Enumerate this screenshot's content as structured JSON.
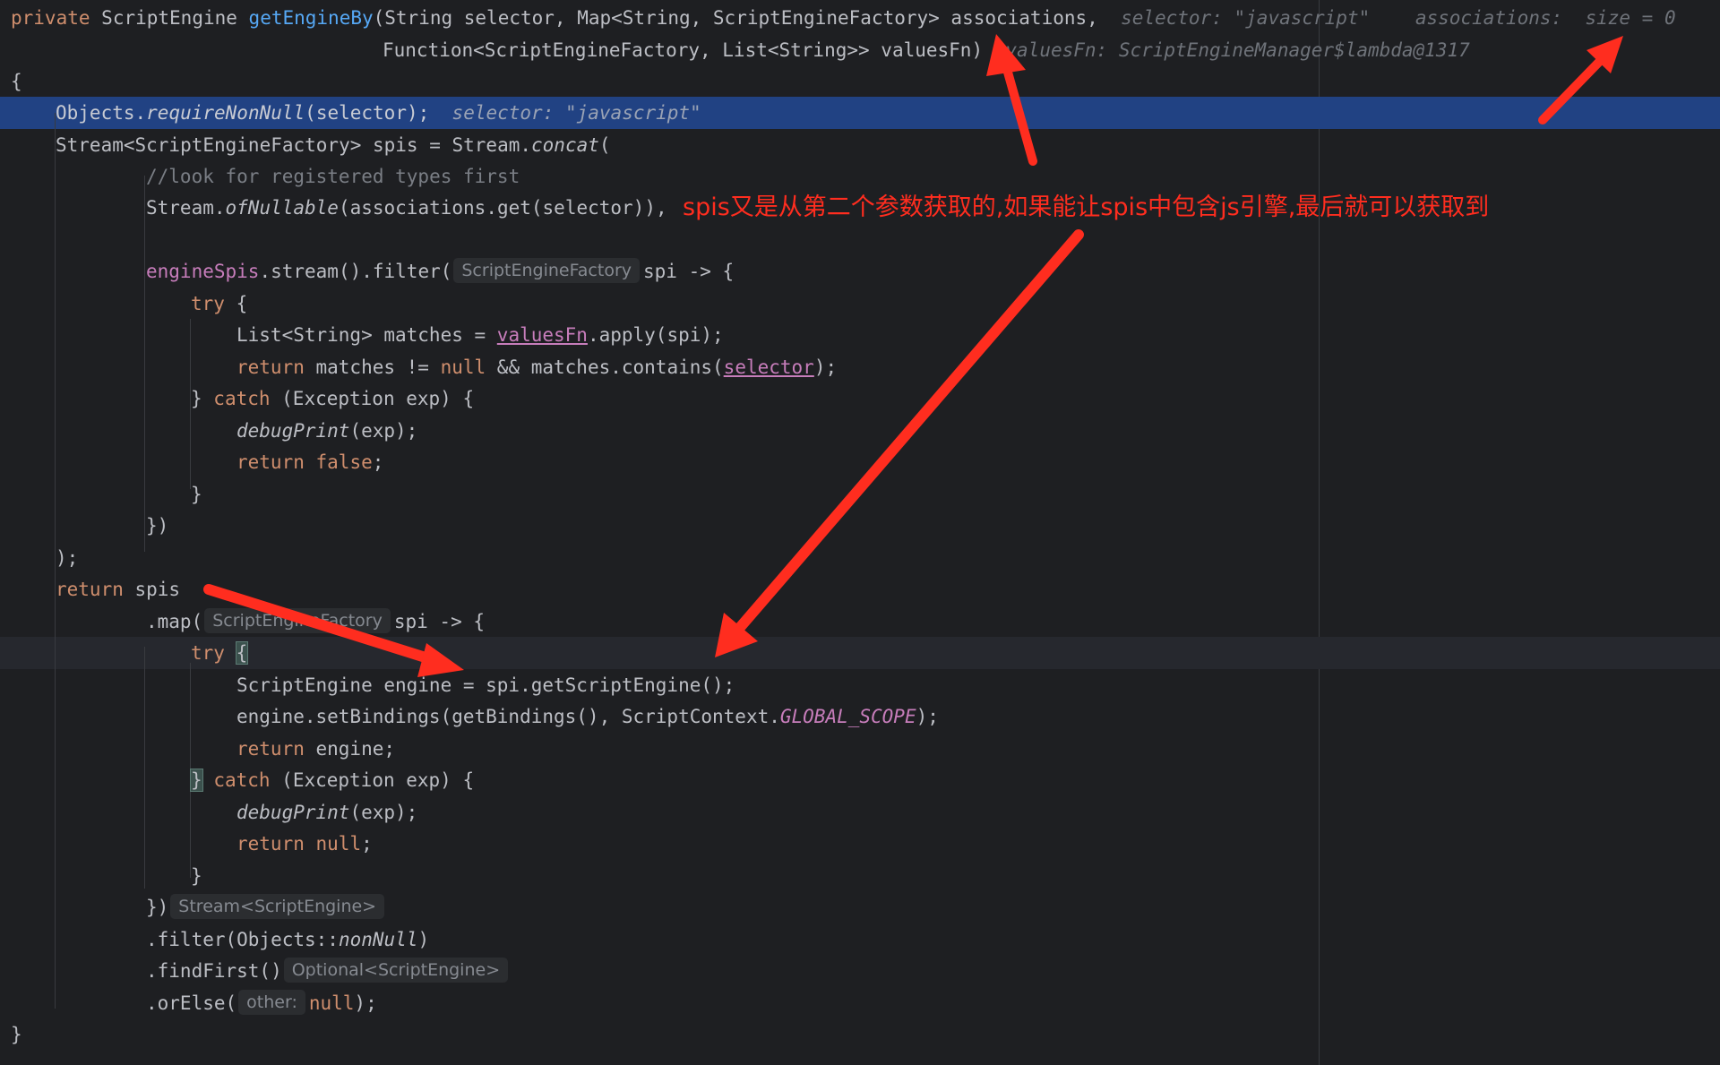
{
  "method": {
    "modifier": "private",
    "return_type": "ScriptEngine",
    "name": "getEngineBy",
    "params_line1": "(String selector, Map<String, ScriptEngineFactory> associations,",
    "params_line2": "Function<ScriptEngineFactory, List<String>> valuesFn)",
    "hint_selector": "selector: \"javascript\"",
    "hint_associations": "associations:  size = 0",
    "hint_valuesFn": "valuesFn: ScriptEngineManager$lambda@1317"
  },
  "code": {
    "open_brace": "{",
    "l4_a": "Objects.",
    "l4_b": "requireNonNull",
    "l4_c": "(selector);",
    "l4_hint": "selector: \"javascript\"",
    "l5_a": "Stream<ScriptEngineFactory> spis = Stream.",
    "l5_b": "concat",
    "l5_c": "(",
    "l6": "//look for registered types first",
    "l7_a": "Stream.",
    "l7_b": "ofNullable",
    "l7_c": "(associations.get(selector)),",
    "l8_field": "engineSpis",
    "l8_a": ".stream().filter(",
    "l8_chip": "ScriptEngineFactory",
    "l8_b": "spi -> {",
    "try": "try",
    "open": " {",
    "l10_a": "List<String> matches = ",
    "l10_b": "valuesFn",
    "l10_c": ".apply(spi);",
    "return": "return",
    "l11_a": " matches != ",
    "null": "null",
    "l11_b": " && matches.contains(",
    "l11_c": "selector",
    "l11_d": ");",
    "catch_a": "} ",
    "catch": "catch",
    "catch_b": " (Exception exp) {",
    "debugPrint": "debugPrint",
    "debug_args": "(exp);",
    "false": "false",
    "semi": ";",
    "close": "}",
    "close_paren_brace": "})",
    "close_paren_semi": ");",
    "l19_b": " spis",
    "l20_a": ".map(",
    "l20_chip": "ScriptEngineFactory",
    "l20_b": "spi -> {",
    "l21_open": "{",
    "l22": "ScriptEngine engine = spi.getScriptEngine();",
    "l23_a": "engine.setBindings(getBindings(), ScriptContext.",
    "l23_b": "GLOBAL_SCOPE",
    "l23_c": ");",
    "l24_b": " engine;",
    "l25_a": "}",
    "l30_chip": "Stream<ScriptEngine>",
    "l31_a": ".filter(Objects::",
    "l31_b": "nonNull",
    "l31_c": ")",
    "l32_a": ".findFirst()",
    "l32_chip": "Optional<ScriptEngine>",
    "l33_a": ".orElse(",
    "l33_chip": "other:",
    "l33_b": "null",
    "l33_c": ");",
    "final_close": "}"
  },
  "annotation": {
    "note": "spis又是从第二个参数获取的,如果能让spis中包含js引擎,最后就可以获取到",
    "color": "#ff2d1f"
  },
  "colors": {
    "background": "#1e1f22",
    "highlight": "#214283",
    "keyword": "#cf8e6d",
    "function": "#56a8f5",
    "field": "#c77dbb"
  }
}
